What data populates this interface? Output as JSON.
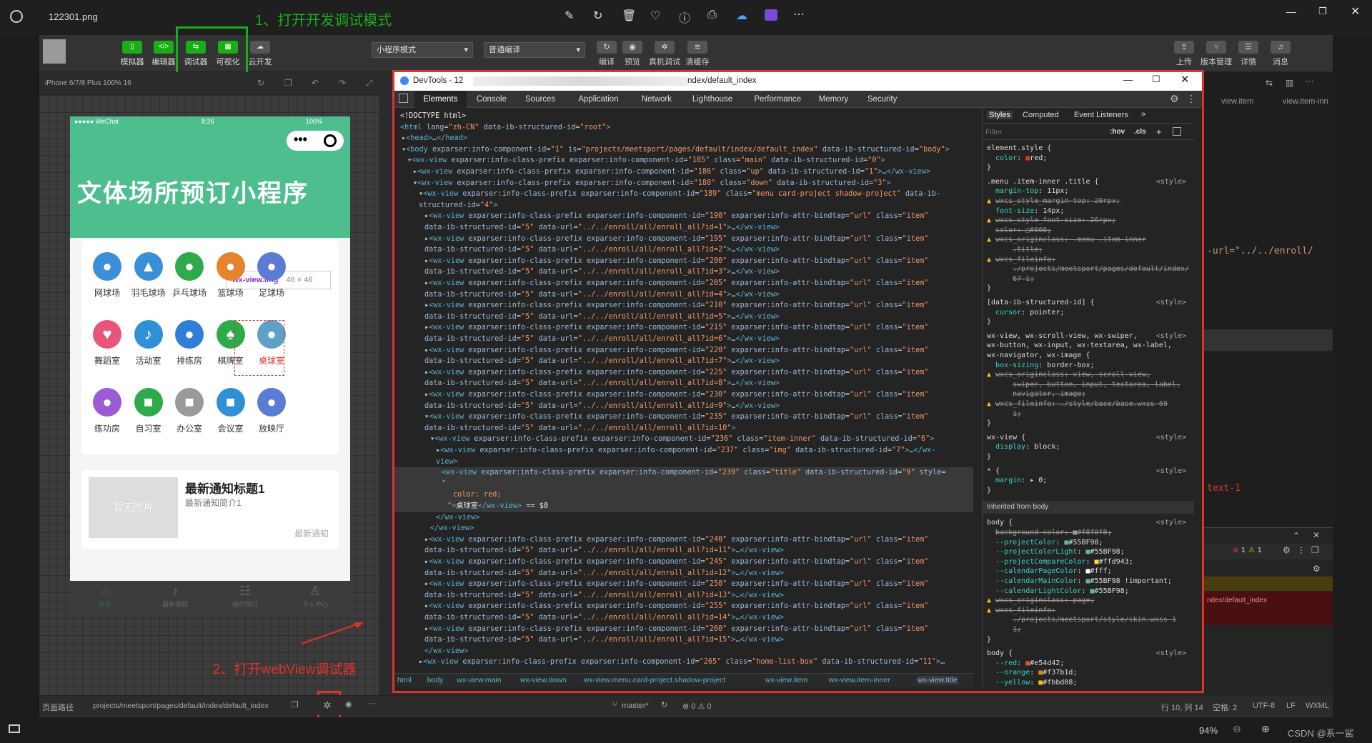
{
  "viewer": {
    "filename": "122301.png",
    "zoom": "94%",
    "watermark": "CSDN @系一鲨"
  },
  "annotations": {
    "step1": "1、打开开发调试模式",
    "step2": "2、打开webView调试器"
  },
  "toolbar": {
    "left_buttons": [
      "模拟器",
      "编辑器",
      "调试器",
      "可视化",
      "云开发"
    ],
    "mode_select": "小程序模式",
    "compile_select": "普通编译",
    "mid_buttons": [
      "编译",
      "预览",
      "真机调试",
      "清缓存"
    ],
    "right_buttons": [
      "上传",
      "版本管理",
      "详情",
      "消息"
    ]
  },
  "simulator": {
    "device": "iPhone 6/7/8 Plus 100% 16",
    "status_carrier": "●●●●● WeChat",
    "status_time": "8:26",
    "status_battery": "100%",
    "page_title": "文体场所预订小程序",
    "grid": [
      {
        "label": "网球场",
        "color": "#3a8fd9",
        "glyph": "●"
      },
      {
        "label": "羽毛球场",
        "color": "#3a8fd9",
        "glyph": "▲"
      },
      {
        "label": "乒乓球场",
        "color": "#2eaa4a",
        "glyph": "●"
      },
      {
        "label": "篮球场",
        "color": "#e6832b",
        "glyph": "●"
      },
      {
        "label": "足球场",
        "color": "#5a7bd6",
        "glyph": "●"
      },
      {
        "label": "舞蹈室",
        "color": "#e8557a",
        "glyph": "♥"
      },
      {
        "label": "活动室",
        "color": "#2f90d8",
        "glyph": "♪"
      },
      {
        "label": "排练房",
        "color": "#2f7fd8",
        "glyph": "●"
      },
      {
        "label": "棋牌室",
        "color": "#2eaa4a",
        "glyph": "♠"
      },
      {
        "label": "桌球室",
        "color": "#5fa0c8",
        "glyph": "●"
      },
      {
        "label": "练功房",
        "color": "#9a5bd6",
        "glyph": "●"
      },
      {
        "label": "自习室",
        "color": "#2eaa4a",
        "glyph": "■"
      },
      {
        "label": "办公室",
        "color": "#9a9a9a",
        "glyph": "■"
      },
      {
        "label": "会议室",
        "color": "#2f90d8",
        "glyph": "■"
      },
      {
        "label": "放映厅",
        "color": "#5a7bd6",
        "glyph": "●"
      }
    ],
    "tooltip_name": "wx-view.img",
    "tooltip_size": "46 × 46",
    "news_placeholder": "暂无图片",
    "news_title": "最新通知标题1",
    "news_desc": "最新通知简介1",
    "news_tag": "最新通知",
    "tabbar": [
      "首页",
      "最新通知",
      "我的预订",
      "个人中心"
    ]
  },
  "devtools": {
    "title_left": "DevTools - 12",
    "title_right": "ndex/default_index",
    "tabs": [
      "Elements",
      "Console",
      "Sources",
      "Application",
      "Network",
      "Lighthouse",
      "Performance",
      "Memory",
      "Security"
    ],
    "styles_tabs": [
      "Styles",
      "Computed",
      "Event Listeners"
    ],
    "filter_placeholder": "Filter",
    "hov": ":hov",
    "cls": ".cls",
    "breadcrumb": [
      "html",
      "body",
      "wx-view.main",
      "wx-view.down",
      "wx-view.menu.card-project.shadow-project",
      "wx-view.item",
      "wx-view.item-inner",
      "wx-view.title"
    ],
    "inherited_label": "Inherited from",
    "inherited_from": "body"
  },
  "editor": {
    "breadcrumb_a": "view.item",
    "breadcrumb_b": "view.item-inn",
    "code_url": "-url=\"../../enroll/",
    "code_text": "text-1",
    "console_errors": "1",
    "console_warnings": "1",
    "console_line": "ndex/default_index"
  },
  "statusbar": {
    "path_label": "页面路径",
    "path": "projects/meetsport/pages/default/index/default_index",
    "branch": "master*",
    "problems": "⊗ 0 ⚠ 0",
    "cursor": "行 10, 列 14",
    "spaces": "空格: 2",
    "encoding": "UTF-8",
    "eol": "LF",
    "lang": "WXML"
  }
}
